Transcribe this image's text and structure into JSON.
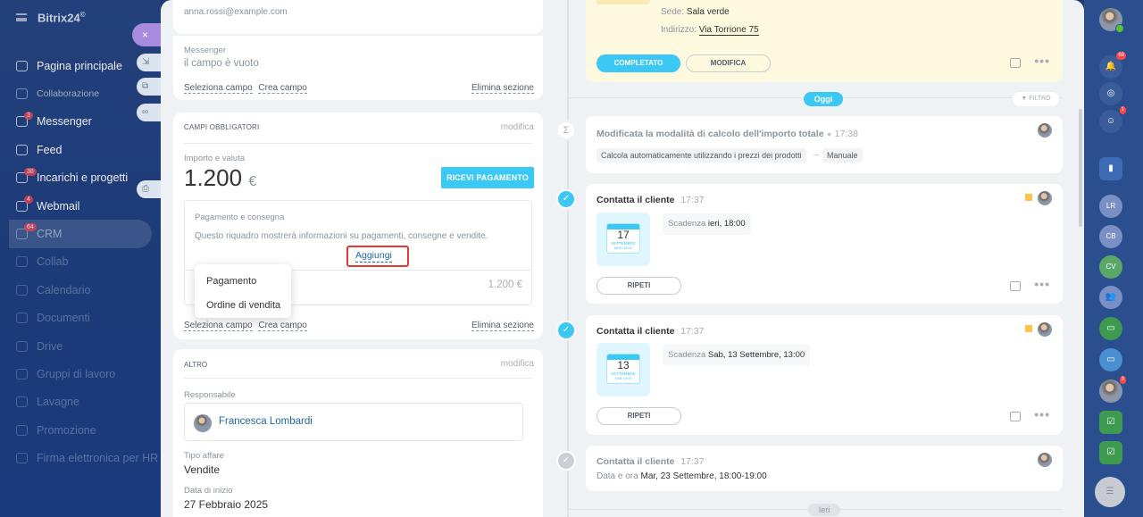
{
  "sidebar": {
    "brand": "Bitrix24",
    "brand_sup": "©",
    "items": [
      {
        "label": "Pagina principale",
        "badge": ""
      },
      {
        "label": "Collaborazione",
        "badge": ""
      },
      {
        "label": "Messenger",
        "badge": "3"
      },
      {
        "label": "Feed",
        "badge": ""
      },
      {
        "label": "Incarichi e progetti",
        "badge": "38"
      },
      {
        "label": "Webmail",
        "badge": "4"
      },
      {
        "label": "CRM",
        "badge": "64"
      },
      {
        "label": "Collab",
        "badge": ""
      },
      {
        "label": "Calendario",
        "badge": ""
      },
      {
        "label": "Documenti",
        "badge": ""
      },
      {
        "label": "Drive",
        "badge": ""
      },
      {
        "label": "Gruppi di lavoro",
        "badge": ""
      },
      {
        "label": "Lavagne",
        "badge": ""
      },
      {
        "label": "Promozione",
        "badge": ""
      },
      {
        "label": "Firma elettronica per HR",
        "badge": ""
      }
    ]
  },
  "tools": {
    "close": "×",
    "t1": "⇲",
    "t2": "⧉",
    "t3": "∞",
    "t4": "⎙"
  },
  "contact": {
    "email": "anna.rossi@example.com",
    "messenger_label": "Messenger",
    "messenger_value": "il campo è vuoto",
    "select_field": "Seleziona campo",
    "create_field": "Crea campo",
    "delete_section": "Elimina sezione"
  },
  "required": {
    "title": "CAMPI OBBLIGATORI",
    "edit": "modifica",
    "amount_label": "Importo e valuta",
    "amount": "1.200",
    "currency": "€",
    "pay_btn": "RICEVI PAGAMENTO",
    "pd_title": "Pagamento e consegna",
    "pd_text": "Questo riquadro mostrerà informazioni su pagamenti, consegne e vendite.",
    "add": "Aggiungi",
    "total": "1.200 €",
    "select_field": "Seleziona campo",
    "create_field": "Crea campo",
    "delete_section": "Elimina sezione"
  },
  "dropdown": {
    "items": [
      "Pagamento",
      "Ordine di vendita"
    ]
  },
  "other": {
    "title": "ALTRO",
    "edit": "modifica",
    "resp_label": "Responsabile",
    "resp_name": "Francesca Lombardi",
    "type_label": "Tipo affare",
    "type_value": "Vendite",
    "date_label": "Data di inizio",
    "date_value": "27 Febbraio 2025"
  },
  "timeline": {
    "meeting": {
      "sede_label": "Sede:",
      "sede": "Sala verde",
      "addr_label": "Indirizzo:",
      "addr": "Via Torrione 75",
      "done_btn": "COMPLETATO",
      "edit_btn": "MODIFICA"
    },
    "today": "Oggi",
    "filter": "FILTRO",
    "calc": {
      "title": "Modificata la modalità di calcolo dell'importo totale",
      "time": "17:38",
      "from": "Calcola automaticamente utilizzando i prezzi dei prodotti",
      "arrow": "→",
      "to": "Manuale"
    },
    "act1": {
      "title": "Contatta il cliente",
      "time": "17:37",
      "day": "17",
      "month": "SETTEMBRE",
      "weekday": "MER 18:00",
      "due_label": "Scadenza",
      "due": "ieri, 18:00",
      "btn": "RIPETI"
    },
    "act2": {
      "title": "Contatta il cliente",
      "time": "17:37",
      "day": "13",
      "month": "SETTEMBRE",
      "weekday": "SAB 13:00",
      "due_label": "Scadenza",
      "due": "Sab, 13 Settembre, 13:00",
      "btn": "RIPETI"
    },
    "act3": {
      "title": "Contatta il cliente",
      "time": "17:37",
      "dt_label": "Data e ora",
      "dt": "Mar, 23 Settembre, 18:00-19:00"
    },
    "yesterday": "Ieri"
  },
  "right": {
    "badge_notif": "69",
    "badge_chat": "1",
    "badge_user": "3",
    "av1": "LR",
    "av2": "CB",
    "av3": "CV"
  },
  "colors": {
    "accent": "#3bc8f5",
    "highlight": "#e53935",
    "sidebar": "#1e3b73"
  }
}
